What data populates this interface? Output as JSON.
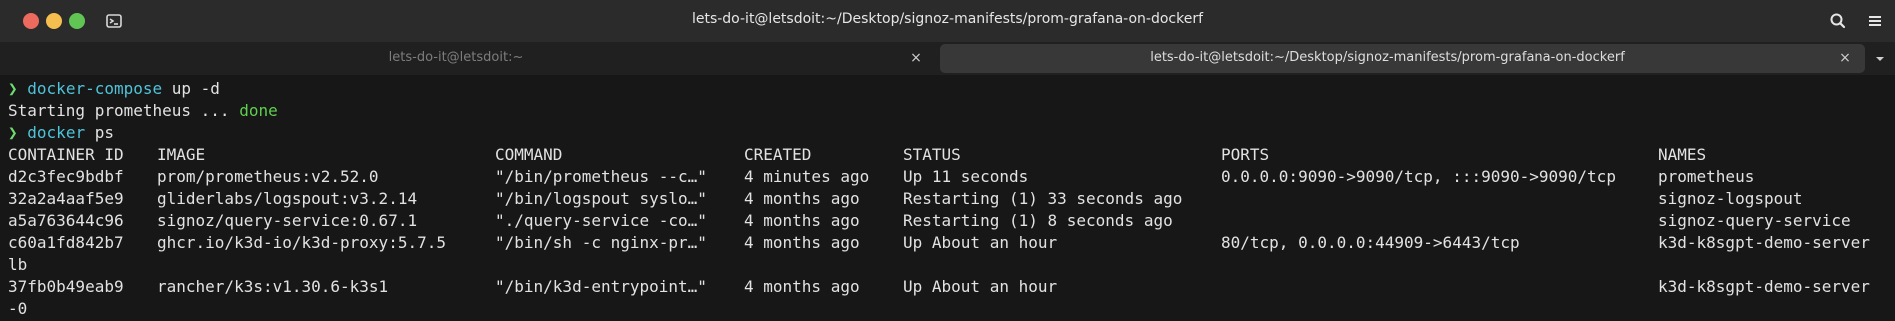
{
  "window": {
    "title": "lets-do-it@letsdoit:~/Desktop/signoz-manifests/prom-grafana-on-dockerf"
  },
  "tabs": [
    {
      "label": "lets-do-it@letsdoit:~",
      "close": "×",
      "active": false
    },
    {
      "label": "lets-do-it@letsdoit:~/Desktop/signoz-manifests/prom-grafana-on-dockerf",
      "close": "×",
      "active": true
    }
  ],
  "icons": {
    "app": "terminal-icon",
    "search": "search-icon",
    "menu": "hamburger-menu-icon",
    "tab_dropdown": "chevron-down-icon"
  },
  "colors": {
    "prompt": "#6fdc6f",
    "command": "#4fc3d9",
    "done": "#5fcf4f",
    "background": "#171717"
  },
  "terminal": {
    "prompt_symbol": "❯",
    "cmd1": {
      "command": "docker-compose",
      "args": " up -d"
    },
    "output1": {
      "text": "Starting prometheus ... ",
      "status": "done"
    },
    "cmd2": {
      "command": "docker",
      "args": " ps"
    },
    "table": {
      "headers": [
        "CONTAINER ID",
        "IMAGE",
        "COMMAND",
        "CREATED",
        "STATUS",
        "PORTS",
        "NAMES"
      ],
      "rows": [
        [
          "d2c3fec9bdbf",
          "prom/prometheus:v2.52.0",
          "\"/bin/prometheus --c…\"",
          "4 minutes ago",
          "Up 11 seconds",
          "0.0.0.0:9090->9090/tcp, :::9090->9090/tcp",
          "prometheus"
        ],
        [
          "32a2a4aaf5e9",
          "gliderlabs/logspout:v3.2.14",
          "\"/bin/logspout syslo…\"",
          "4 months ago",
          "Restarting (1) 33 seconds ago",
          "",
          "signoz-logspout"
        ],
        [
          "a5a763644c96",
          "signoz/query-service:0.67.1",
          "\"./query-service -co…\"",
          "4 months ago",
          "Restarting (1) 8 seconds ago",
          "",
          "signoz-query-service"
        ],
        [
          "c60a1fd842b7",
          "ghcr.io/k3d-io/k3d-proxy:5.7.5",
          "\"/bin/sh -c nginx-pr…\"",
          "4 months ago",
          "Up About an hour",
          "80/tcp, 0.0.0.0:44909->6443/tcp",
          "k3d-k8sgpt-demo-server"
        ],
        [
          "37fb0b49eab9",
          "rancher/k3s:v1.30.6-k3s1",
          "\"/bin/k3d-entrypoint…\"",
          "4 months ago",
          "Up About an hour",
          "",
          "k3d-k8sgpt-demo-server"
        ]
      ],
      "wraps": [
        "lb",
        "-0"
      ]
    }
  }
}
